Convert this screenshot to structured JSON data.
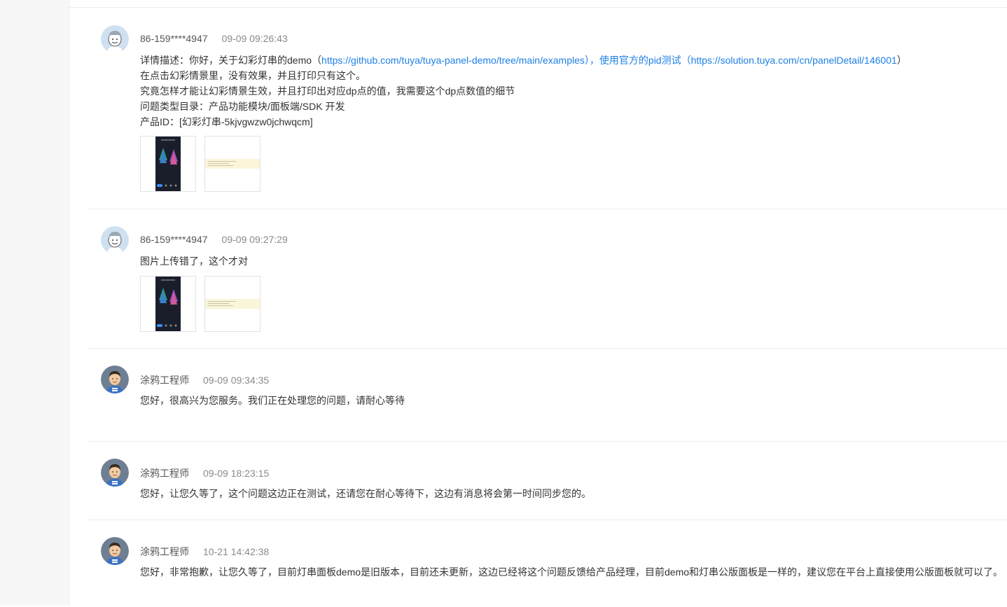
{
  "colors": {
    "link": "#1e80e6",
    "time": "#8a8a8a",
    "text": "#333333"
  },
  "messages": [
    {
      "author": "86-159****4947",
      "time": "09-09 09:26:43",
      "avatar": "customer-avatar",
      "line1_prefix": "详情描述：你好，关于幻彩灯串的demo（",
      "line1_link1": "https://github.com/tuya/tuya-panel-demo/tree/main/examples",
      "line1_mid": "），使用官方的pid测试（",
      "line1_link2": "https://solution.tuya.com/cn/panelDetail/146001",
      "line1_suffix": "）",
      "line2": "在点击幻彩情景里，没有效果，并且打印只有这个。",
      "line3": "究竟怎样才能让幻彩情景生效，并且打印出对应dp点的值，我需要这个dp点数值的细节",
      "line4": "问题类型目录：产品功能模块/面板端/SDK 开发",
      "line5": "产品ID：[幻彩灯串-5kjvgwzw0jchwqcm]",
      "attachments": [
        "phone-screenshot",
        "log-screenshot"
      ]
    },
    {
      "author": "86-159****4947",
      "time": "09-09 09:27:29",
      "avatar": "customer-avatar",
      "text": "图片上传错了，这个才对",
      "attachments": [
        "phone-screenshot",
        "log-screenshot"
      ]
    },
    {
      "author": "涂鸦工程师",
      "time": "09-09 09:34:35",
      "avatar": "engineer-avatar",
      "text": "您好，很高兴为您服务。我们正在处理您的问题，请耐心等待"
    },
    {
      "author": "涂鸦工程师",
      "time": "09-09 18:23:15",
      "avatar": "engineer-avatar",
      "text": "您好，让您久等了，这个问题这边正在测试，还请您在耐心等待下，这边有消息将会第一时间同步您的。"
    },
    {
      "author": "涂鸦工程师",
      "time": "10-21 14:42:38",
      "avatar": "engineer-avatar",
      "text": "您好，非常抱歉，让您久等了，目前灯串面板demo是旧版本，目前还未更新，这边已经将这个问题反馈给产品经理，目前demo和灯串公版面板是一样的，建议您在平台上直接使用公版面板就可以了。"
    }
  ]
}
